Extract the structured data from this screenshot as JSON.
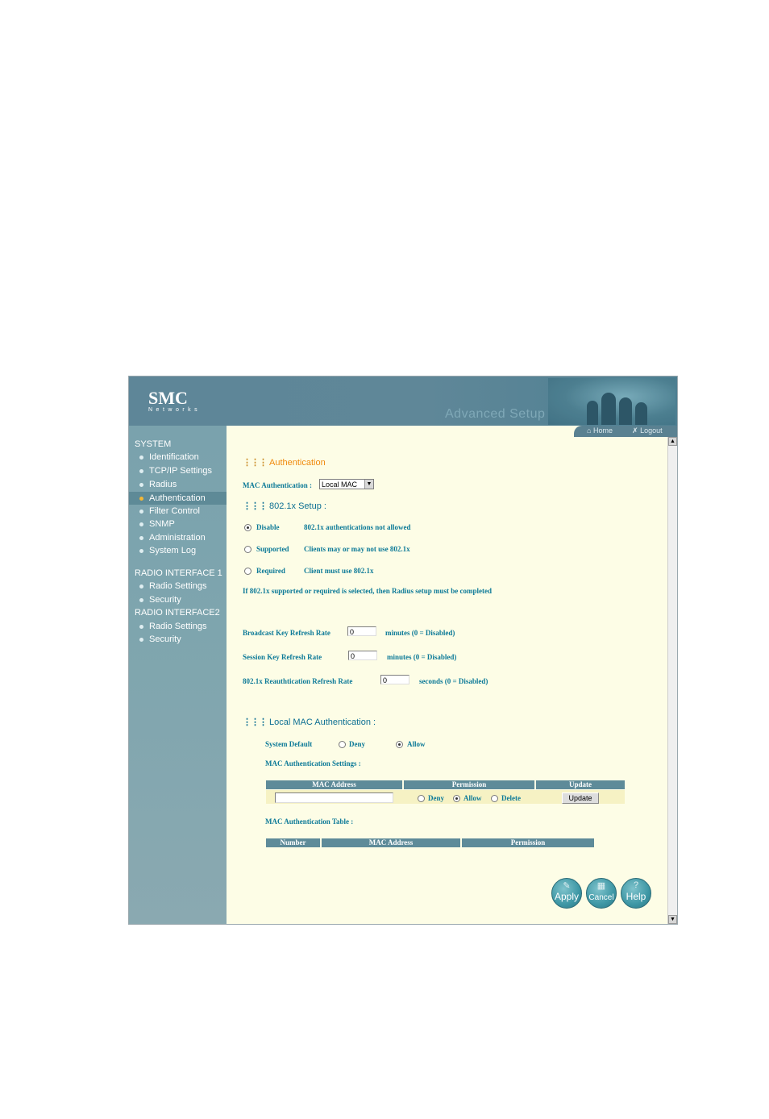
{
  "header": {
    "brand": "SMC",
    "brand_sub": "Networks",
    "banner_title": "Advanced Setup",
    "home_link": "Home",
    "logout_link": "Logout"
  },
  "sidebar": {
    "system_heading": "SYSTEM",
    "system_items": [
      "Identification",
      "TCP/IP Settings",
      "Radius",
      "Authentication",
      "Filter Control",
      "SNMP",
      "Administration",
      "System Log"
    ],
    "active_item": "Authentication",
    "radio1_heading": "RADIO INTERFACE 1",
    "radio1_items": [
      "Radio Settings",
      "Security"
    ],
    "radio2_heading": "RADIO INTERFACE2",
    "radio2_items": [
      "Radio Settings",
      "Security"
    ]
  },
  "content": {
    "title": "Authentication",
    "mac_auth_label": "MAC Authentication :",
    "mac_auth_value": "Local MAC",
    "setup_title": "802.1x Setup :",
    "modes": [
      {
        "label": "Disable",
        "desc": "802.1x authentications not allowed",
        "checked": true
      },
      {
        "label": "Supported",
        "desc": "Clients may or may not use 802.1x",
        "checked": false
      },
      {
        "label": "Required",
        "desc": "Client must use 802.1x",
        "checked": false
      }
    ],
    "note": "If 802.1x supported or required is selected, then Radius setup must be completed",
    "broadcast_label": "Broadcast Key Refresh Rate",
    "broadcast_value": "0",
    "broadcast_unit": "minutes (0 = Disabled)",
    "session_label": "Session Key Refresh Rate",
    "session_value": "0",
    "session_unit": "minutes (0 = Disabled)",
    "reauth_label": "802.1x Reauthtication Refresh Rate",
    "reauth_value": "0",
    "reauth_unit": "seconds (0 = Disabled)",
    "local_mac_title": "Local MAC Authentication :",
    "system_default_label": "System Default",
    "deny_label": "Deny",
    "allow_label": "Allow",
    "system_default_value": "Allow",
    "settings_label": "MAC Authentication Settings :",
    "settings_table": {
      "headers": [
        "MAC Address",
        "Permission",
        "Update"
      ],
      "mac_value": "",
      "perm_options": [
        "Deny",
        "Allow",
        "Delete"
      ],
      "perm_selected": "Allow",
      "update_button": "Update"
    },
    "mac_table_label": "MAC Authentication Table :",
    "mac_table_headers": [
      "Number",
      "MAC Address",
      "Permission"
    ]
  },
  "buttons": {
    "apply": "Apply",
    "cancel": "Cancel",
    "help": "Help"
  },
  "colors": {
    "accent_orange": "#f08a0d",
    "text_teal": "#0d7a98",
    "nav_bg": "#7aa2ad",
    "content_bg": "#fdfde6"
  }
}
